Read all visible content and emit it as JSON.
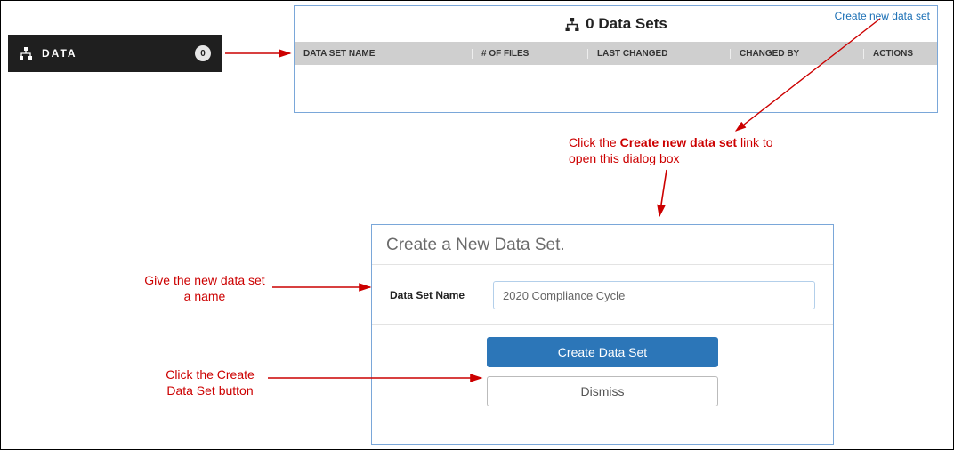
{
  "sidebar": {
    "label": "DATA",
    "count": "0"
  },
  "panel": {
    "title_count": "0",
    "title_text": "Data Sets",
    "create_link": "Create new data set",
    "columns": {
      "name": "DATA SET NAME",
      "files": "# OF FILES",
      "changed": "LAST CHANGED",
      "by": "CHANGED BY",
      "actions": "ACTIONS"
    }
  },
  "dialog": {
    "title": "Create a New Data Set.",
    "field_label": "Data Set Name",
    "field_value": "2020 Compliance Cycle",
    "primary": "Create Data Set",
    "secondary": "Dismiss"
  },
  "annotations": {
    "a1_pre": "Click the ",
    "a1_bold": "Create new data set",
    "a1_post": " link to open this dialog box",
    "a2": "Give the new data set a name",
    "a3": "Click the Create Data Set button"
  }
}
